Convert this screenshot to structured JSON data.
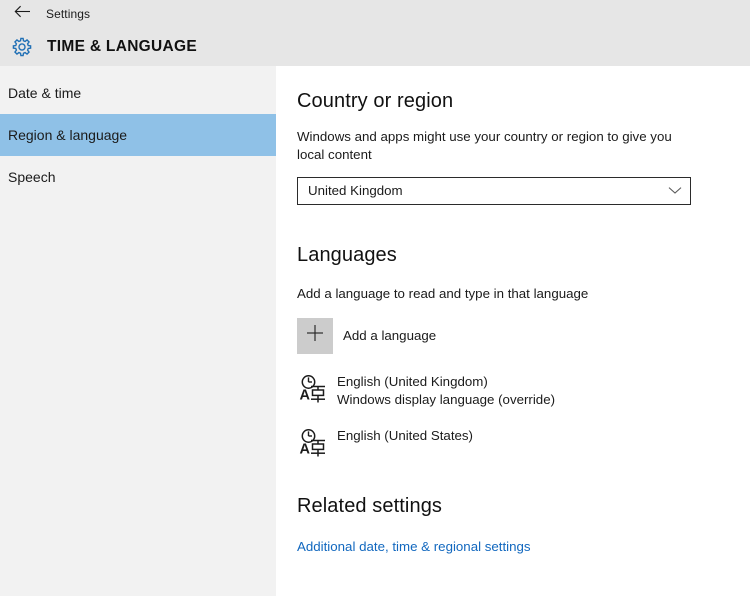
{
  "titlebar": {
    "back_icon": "back-arrow-icon",
    "title": "Settings"
  },
  "header": {
    "icon": "gear-icon",
    "title": "TIME & LANGUAGE"
  },
  "sidebar": {
    "items": [
      {
        "label": "Date & time",
        "selected": false
      },
      {
        "label": "Region & language",
        "selected": true
      },
      {
        "label": "Speech",
        "selected": false
      }
    ]
  },
  "main": {
    "country": {
      "heading": "Country or region",
      "description": "Windows and apps might use your country or region to give you local content",
      "dropdown": {
        "value": "United Kingdom",
        "icon": "chevron-down-icon"
      }
    },
    "languages": {
      "heading": "Languages",
      "description": "Add a language to read and type in that language",
      "add_button": {
        "icon": "plus-icon",
        "label": "Add a language"
      },
      "items": [
        {
          "icon": "language-icon",
          "name": "English (United Kingdom)",
          "sub": "Windows display language (override)"
        },
        {
          "icon": "language-icon",
          "name": "English (United States)",
          "sub": ""
        }
      ]
    },
    "related": {
      "heading": "Related settings",
      "link": "Additional date, time & regional settings"
    }
  },
  "colors": {
    "header_band": "#e6e6e6",
    "sidebar_bg": "#f2f2f2",
    "selection_blue": "#8fc1e7",
    "accent_link": "#1268bf",
    "gear_blue": "#1f6fb5"
  }
}
